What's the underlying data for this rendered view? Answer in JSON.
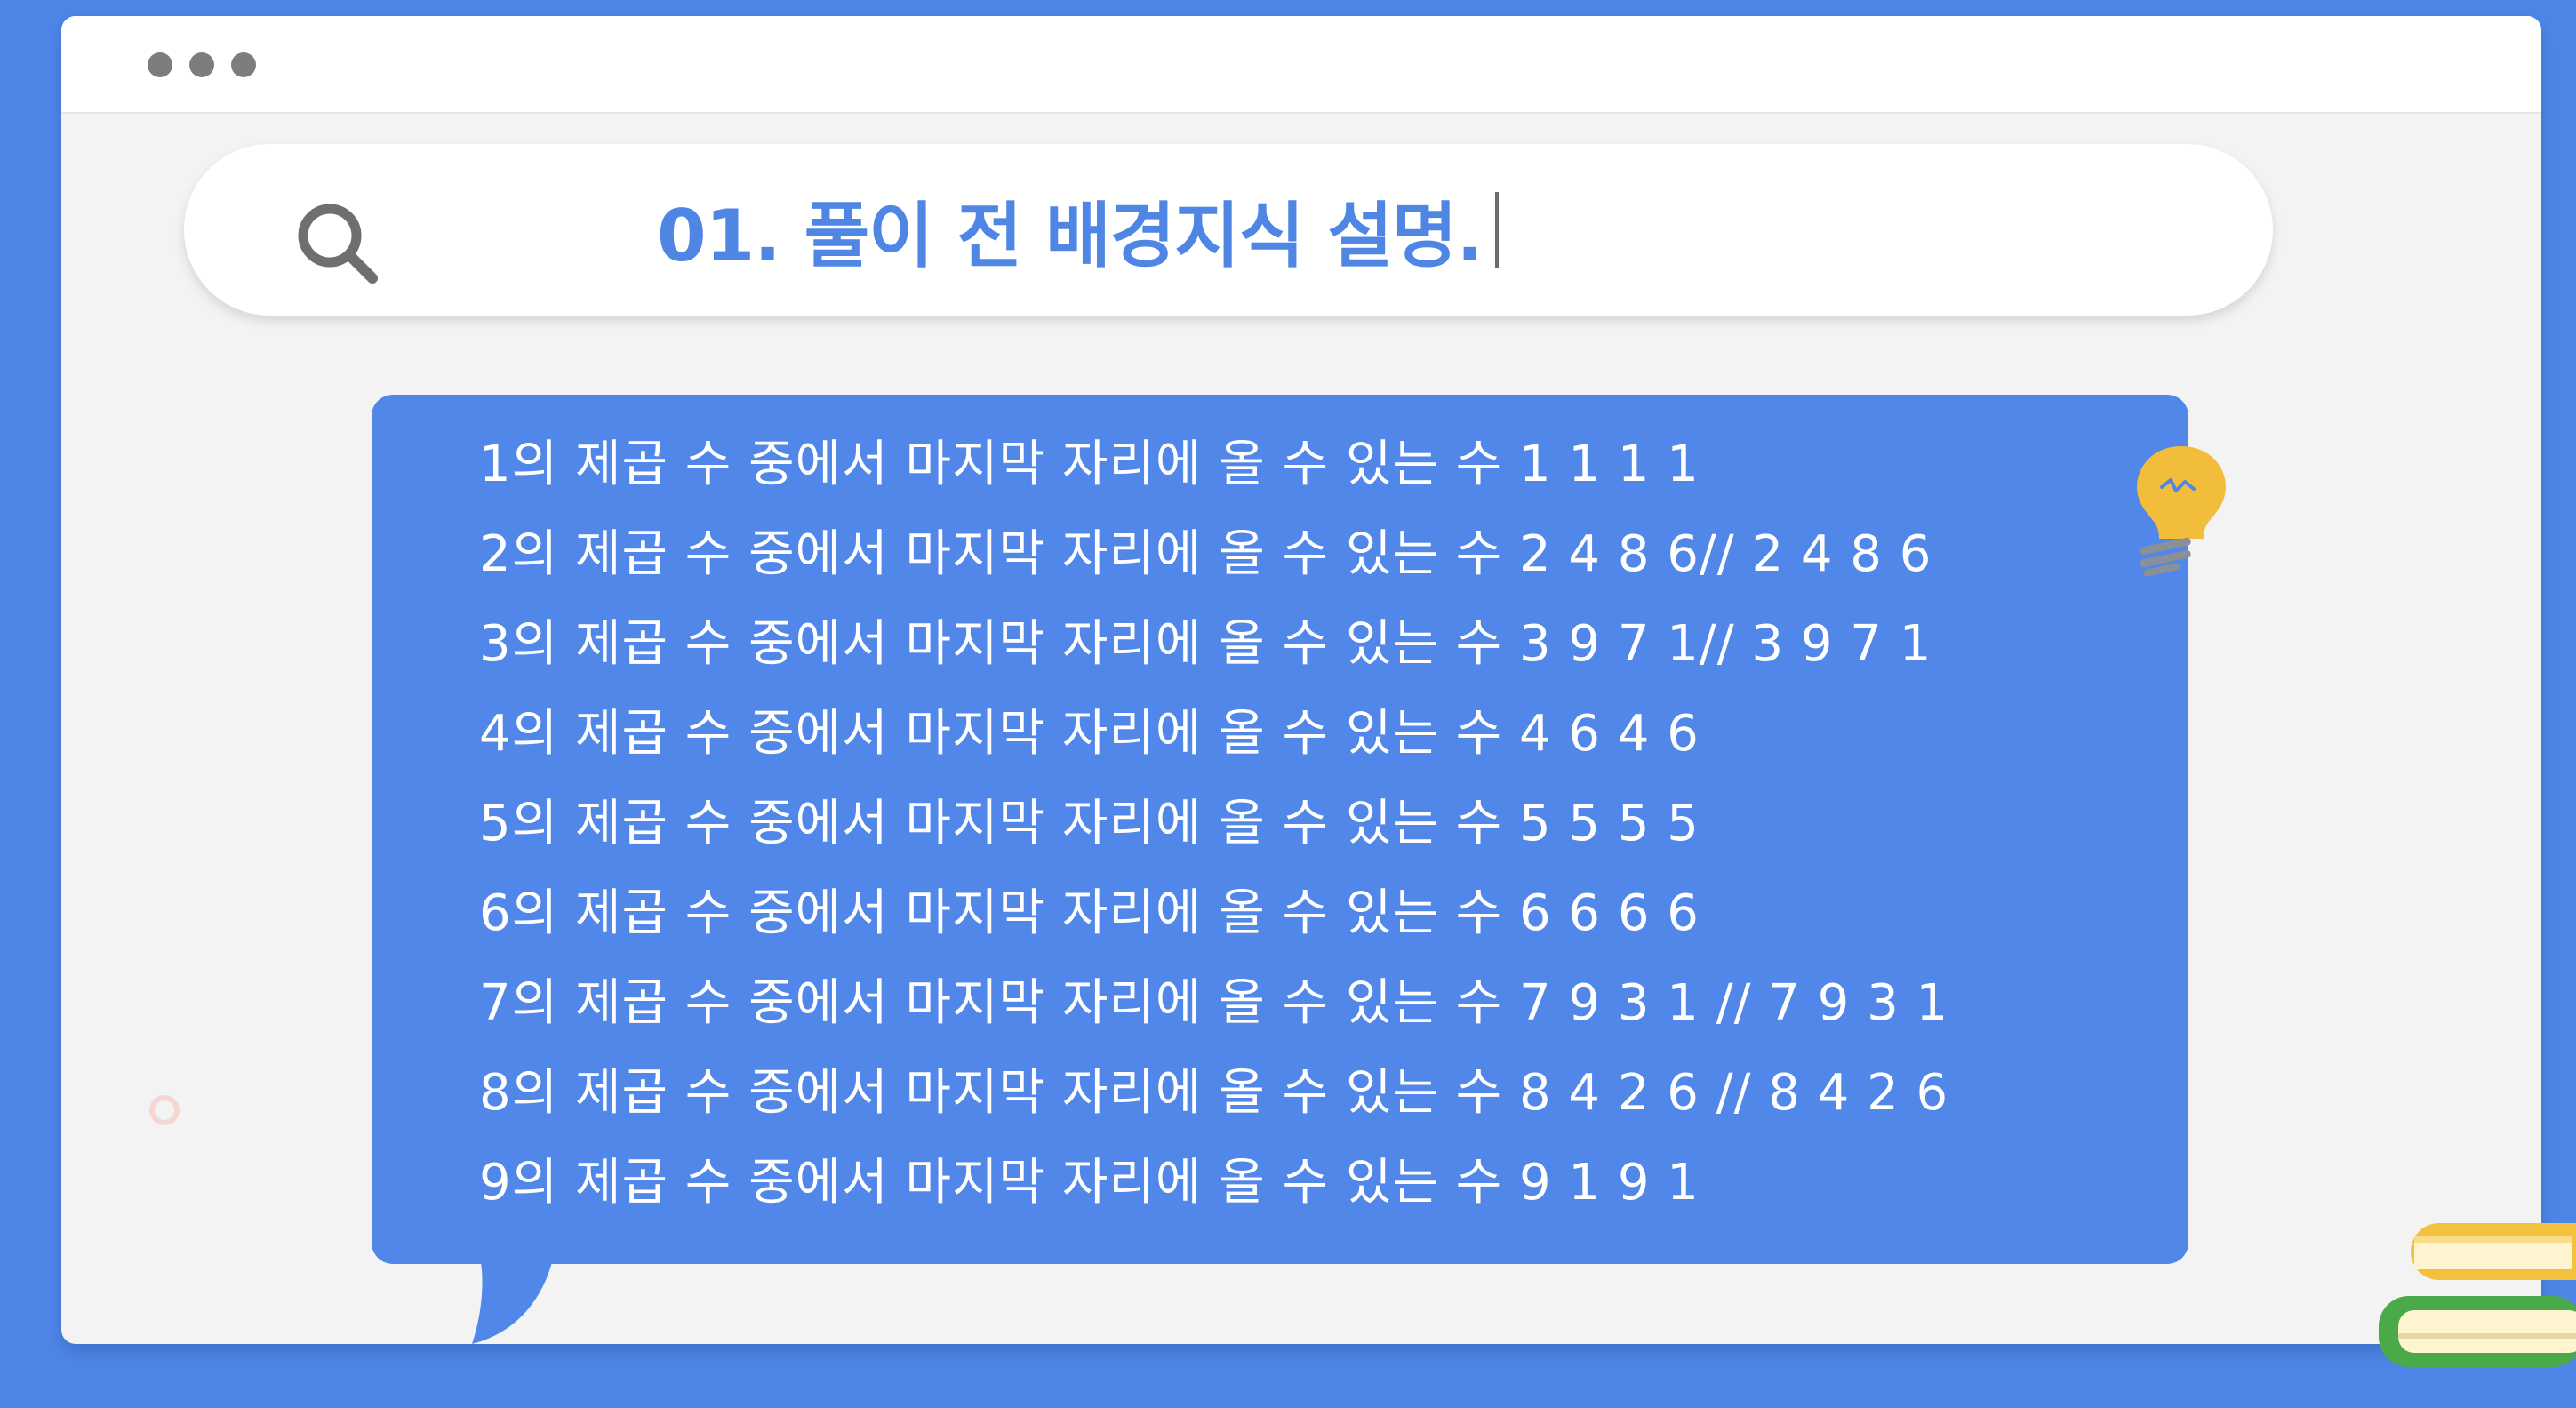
{
  "window": {
    "controls": [
      "dot",
      "dot",
      "dot"
    ]
  },
  "search": {
    "icon": "search-icon",
    "query": "01. 풀이 전 배경지식 설명."
  },
  "bubble": {
    "lines": [
      "1의 제곱 수 중에서 마지막 자리에 올 수 있는 수 1 1 1 1",
      "2의 제곱 수 중에서 마지막 자리에 올 수 있는 수 2 4 8 6// 2 4 8 6",
      "3의 제곱 수 중에서 마지막 자리에 올 수 있는 수 3 9 7 1// 3 9 7 1",
      "4의 제곱 수 중에서 마지막 자리에 올 수 있는 수 4 6 4 6",
      "5의 제곱 수 중에서 마지막 자리에 올 수 있는 수 5 5 5 5",
      "6의 제곱 수 중에서 마지막 자리에 올 수 있는 수 6 6 6 6",
      "7의 제곱 수 중에서 마지막 자리에 올 수 있는 수 7 9 3 1 // 7 9 3 1",
      "8의 제곱 수 중에서 마지막 자리에 올 수 있는 수 8 4 2 6 // 8 4 2 6",
      "9의 제곱 수 중에서 마지막 자리에 올 수 있는 수 9 1 9 1"
    ]
  },
  "decorations": {
    "bulb": "lightbulb-icon",
    "books": "books-icon",
    "ring": "ring-icon"
  },
  "colors": {
    "background": "#4e86e8",
    "window": "#f3f3f3",
    "accent": "#4f86e4",
    "bubble": "#5087e9",
    "bulb": "#f3bd3c",
    "books_yellow": "#f4c13f",
    "books_green": "#4aa948"
  }
}
